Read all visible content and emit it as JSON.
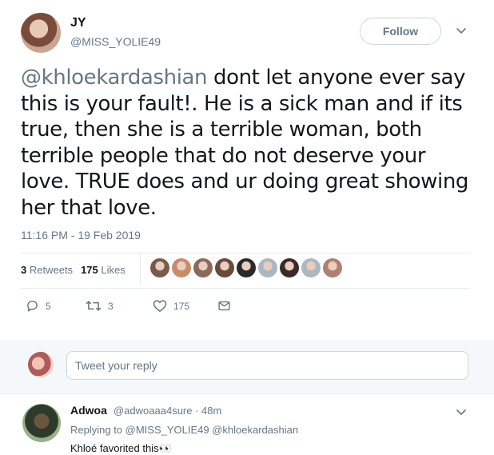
{
  "tweet": {
    "display_name": "JY",
    "handle": "@MISS_YOLIE49",
    "follow_label": "Follow",
    "text_mention": "@khloekardashian",
    "text_body": " dont let anyone ever say this is your fault!. He is a sick man and if its true, then she is a terrible woman, both terrible people that do not deserve your love. TRUE does and ur doing great showing her that love.",
    "timestamp": "11:16 PM - 19 Feb 2019",
    "retweets_count": "3",
    "retweets_label": "Retweets",
    "likes_count": "175",
    "likes_label": "Likes",
    "likers": [
      "#7a5a4a",
      "#c98b6a",
      "#8a6a5a",
      "#6a4a3a",
      "#2a2a2a",
      "#aab8c2",
      "#3a2a2a",
      "#aab8c2",
      "#b08070"
    ]
  },
  "actions": {
    "reply_count": "5",
    "retweet_count": "3",
    "like_count": "175"
  },
  "reply_box": {
    "placeholder": "Tweet your reply"
  },
  "reply": {
    "name": "Adwoa",
    "handle_time": "@adwoaaa4sure · 48m",
    "replying_to": "Replying to @MISS_YOLIE49 @khloekardashian",
    "text": "Khloé favorited this👀"
  },
  "colors": {
    "text": "#14171a",
    "secondary": "#657786",
    "border": "#e6ecf0",
    "reply_bar_bg": "#f5f8fa"
  },
  "icons": [
    "chevron-down-icon",
    "reply-icon",
    "retweet-icon",
    "heart-icon",
    "message-icon"
  ]
}
